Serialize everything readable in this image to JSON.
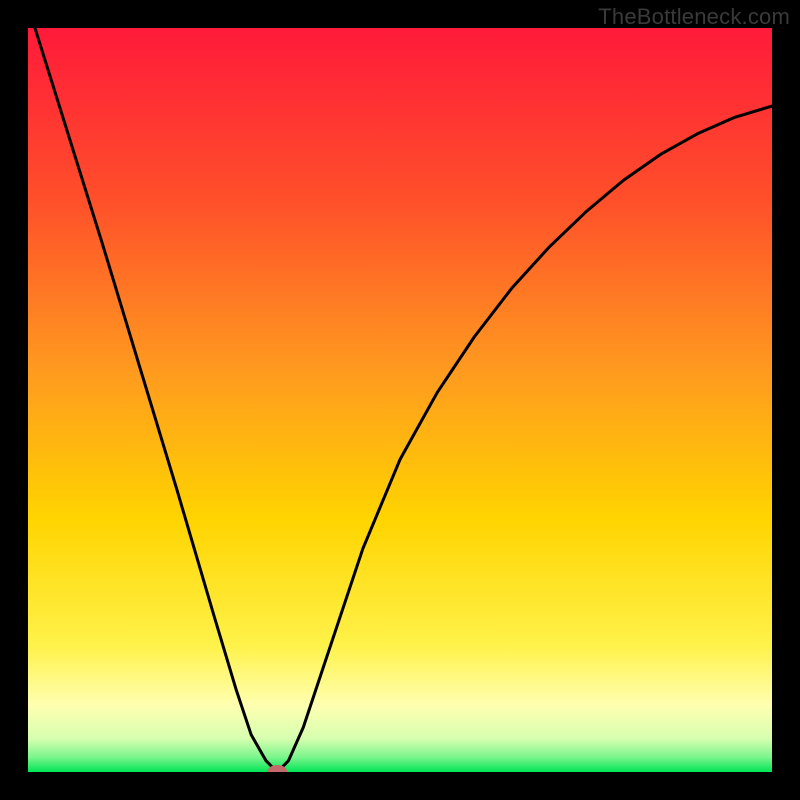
{
  "watermark": "TheBottleneck.com",
  "chart_data": {
    "type": "line",
    "title": "",
    "xlabel": "",
    "ylabel": "",
    "xlim": [
      0,
      1
    ],
    "ylim": [
      0,
      1
    ],
    "background_gradient": {
      "top_color": "#ff1a3a",
      "mid_upper_color": "#ff7a1f",
      "mid_color": "#ffd400",
      "mid_lower_color": "#ffff8a",
      "bottom_color": "#00e556"
    },
    "series": [
      {
        "name": "bottleneck-curve",
        "color": "#000000",
        "x": [
          0.0,
          0.05,
          0.1,
          0.15,
          0.2,
          0.25,
          0.28,
          0.3,
          0.32,
          0.335,
          0.35,
          0.37,
          0.4,
          0.45,
          0.5,
          0.55,
          0.6,
          0.65,
          0.7,
          0.75,
          0.8,
          0.85,
          0.9,
          0.95,
          1.0
        ],
        "values": [
          1.03,
          0.87,
          0.71,
          0.545,
          0.38,
          0.21,
          0.11,
          0.05,
          0.015,
          0.0,
          0.015,
          0.06,
          0.15,
          0.3,
          0.42,
          0.51,
          0.585,
          0.65,
          0.705,
          0.753,
          0.795,
          0.83,
          0.858,
          0.88,
          0.895
        ]
      }
    ],
    "marker": {
      "x": 0.335,
      "y": 0.0,
      "color": "#c46a68",
      "rx": 10,
      "ry": 7
    }
  }
}
